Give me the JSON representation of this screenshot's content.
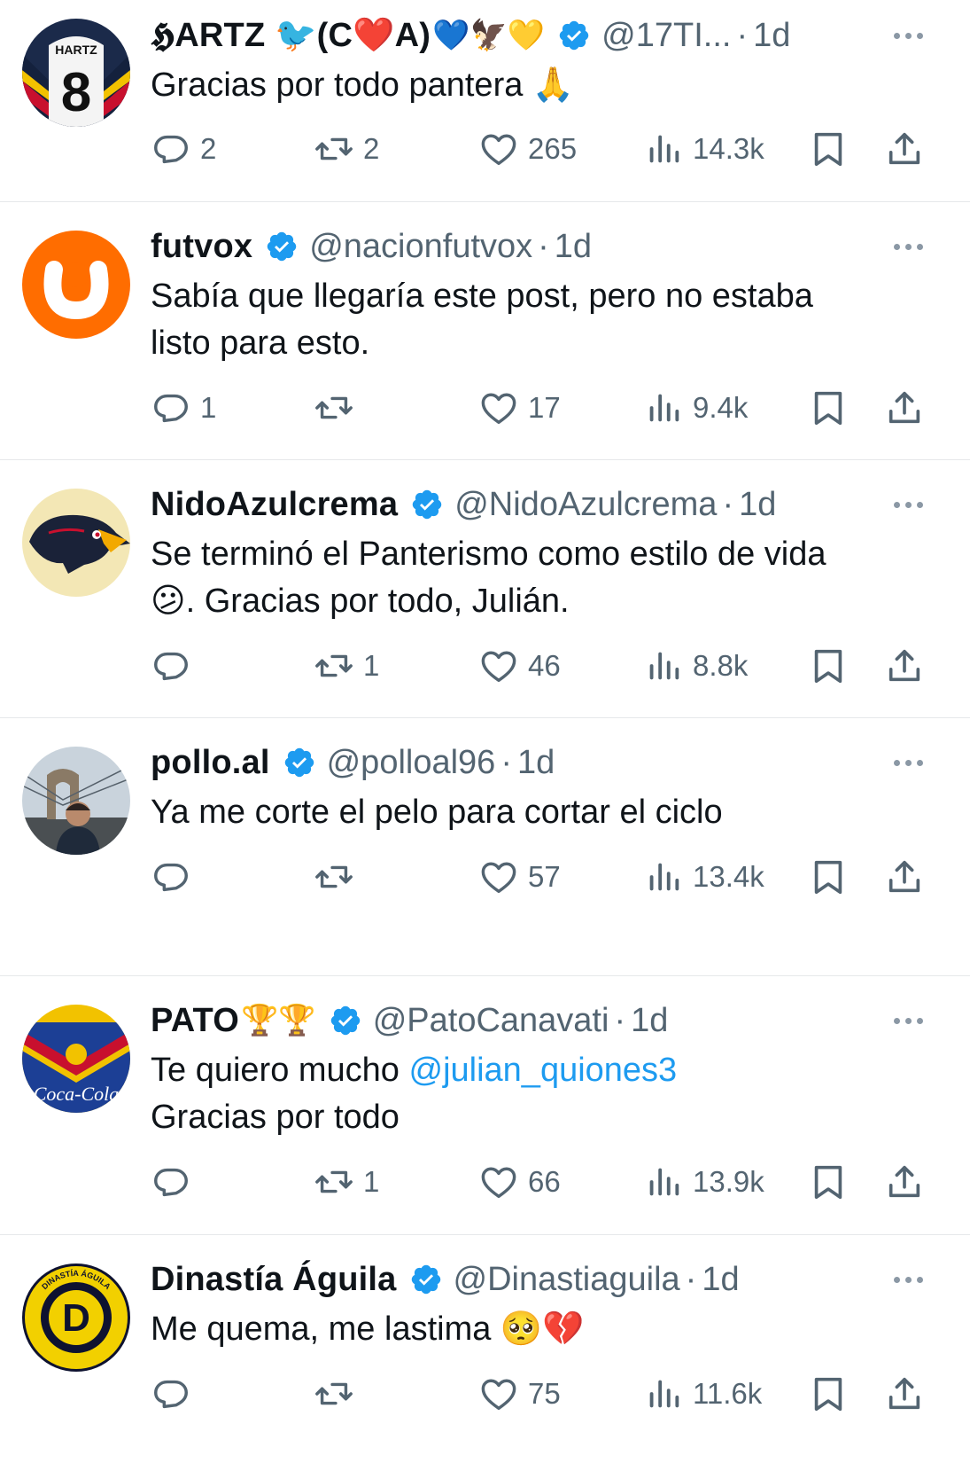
{
  "colors": {
    "accent": "#1d9bf0",
    "text": "#0f1419",
    "muted": "#536471",
    "divider": "#e6e8ea"
  },
  "tweets": [
    {
      "name": "𝕳ARTZ 🐦(C❤️A)",
      "emoji": "💙🦅💛",
      "verified": true,
      "handle": "@17TI...",
      "time": "1d",
      "text": "Gracias por todo pantera 🙏",
      "replies": "2",
      "retweets": "2",
      "likes": "265",
      "views": "14.3k",
      "avatar_icon": "jersey-8-icon",
      "avatar_text": "HARTZ",
      "avatar_number": "8"
    },
    {
      "name": "futvox",
      "emoji": "",
      "verified": true,
      "handle": "@nacionfutvox",
      "time": "1d",
      "text": "Sabía que llegaría este post, pero no estaba\nlisto para esto.",
      "replies": "1",
      "retweets": "",
      "likes": "17",
      "views": "9.4k",
      "avatar_icon": "futvox-logo-icon"
    },
    {
      "name": "NidoAzulcrema",
      "emoji": "",
      "verified": true,
      "handle": "@NidoAzulcrema",
      "time": "1d",
      "text": "Se terminó el Panterismo como estilo de vida\n😕. Gracias por todo, Julián.",
      "replies": "",
      "retweets": "1",
      "likes": "46",
      "views": "8.8k",
      "avatar_icon": "eagle-logo-icon"
    },
    {
      "name": "pollo.al",
      "emoji": "",
      "verified": true,
      "handle": "@polloal96",
      "time": "1d",
      "text": "Ya me corte el pelo para cortar el ciclo",
      "replies": "",
      "retweets": "",
      "likes": "57",
      "views": "13.4k",
      "avatar_icon": "bridge-photo-icon"
    },
    {
      "name": "PATO",
      "emoji": "🏆🏆",
      "verified": true,
      "handle": "@PatoCanavati",
      "time": "1d",
      "text_before": "Te quiero mucho ",
      "mention": "@julian_quiones3",
      "text_after": "\nGracias por todo",
      "replies": "",
      "retweets": "1",
      "likes": "66",
      "views": "13.9k",
      "avatar_icon": "america-jersey-icon",
      "avatar_text": "Coca-Cola"
    },
    {
      "name": "Dinastía Águila",
      "emoji": "",
      "verified": true,
      "handle": "@Dinastiaguila",
      "time": "1d",
      "text": "Me quema, me lastima 🥺💔",
      "replies": "",
      "retweets": "",
      "likes": "75",
      "views": "11.6k",
      "avatar_icon": "dinastia-aguila-logo-icon",
      "avatar_text": "DINASTÍA ÁGUILA",
      "avatar_letter": "D"
    }
  ]
}
